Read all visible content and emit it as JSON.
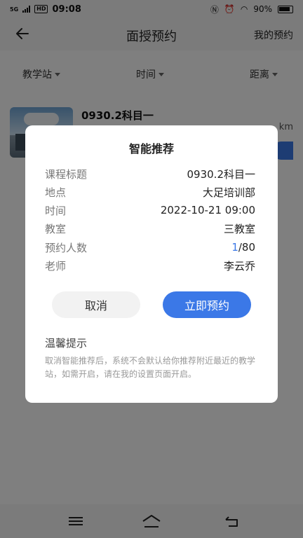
{
  "status": {
    "time": "09:08",
    "network": "5G",
    "hd": "HD",
    "battery": "90%"
  },
  "header": {
    "title": "面授预约",
    "right_link": "我的预约"
  },
  "filters": [
    {
      "label": "教学站"
    },
    {
      "label": "时间"
    },
    {
      "label": "距离"
    }
  ],
  "card": {
    "title": "0930.2科目一",
    "distance_suffix": "km"
  },
  "dialog": {
    "title": "智能推荐",
    "rows": [
      {
        "key": "课程标题",
        "value": "0930.2科目一"
      },
      {
        "key": "地点",
        "value": "大足培训部"
      },
      {
        "key": "时间",
        "value": "2022-10-21 09:00"
      },
      {
        "key": "教室",
        "value": "三教室"
      },
      {
        "key": "预约人数",
        "value_highlight": "1",
        "value_rest": "/80"
      },
      {
        "key": "老师",
        "value": "李云乔"
      }
    ],
    "cancel_label": "取消",
    "confirm_label": "立即预约",
    "tips_title": "温馨提示",
    "tips_text": "取消智能推荐后，系统不会默认给你推荐附近最近的教学站，如需开启，请在我的设置页面开启。"
  },
  "colors": {
    "accent": "#3b78e7",
    "overlay": "rgba(0,0,0,0.5)"
  },
  "icons": {
    "back": "arrow-left-icon",
    "nav_menu": "menu-icon",
    "nav_home": "home-icon",
    "nav_back": "return-icon"
  }
}
